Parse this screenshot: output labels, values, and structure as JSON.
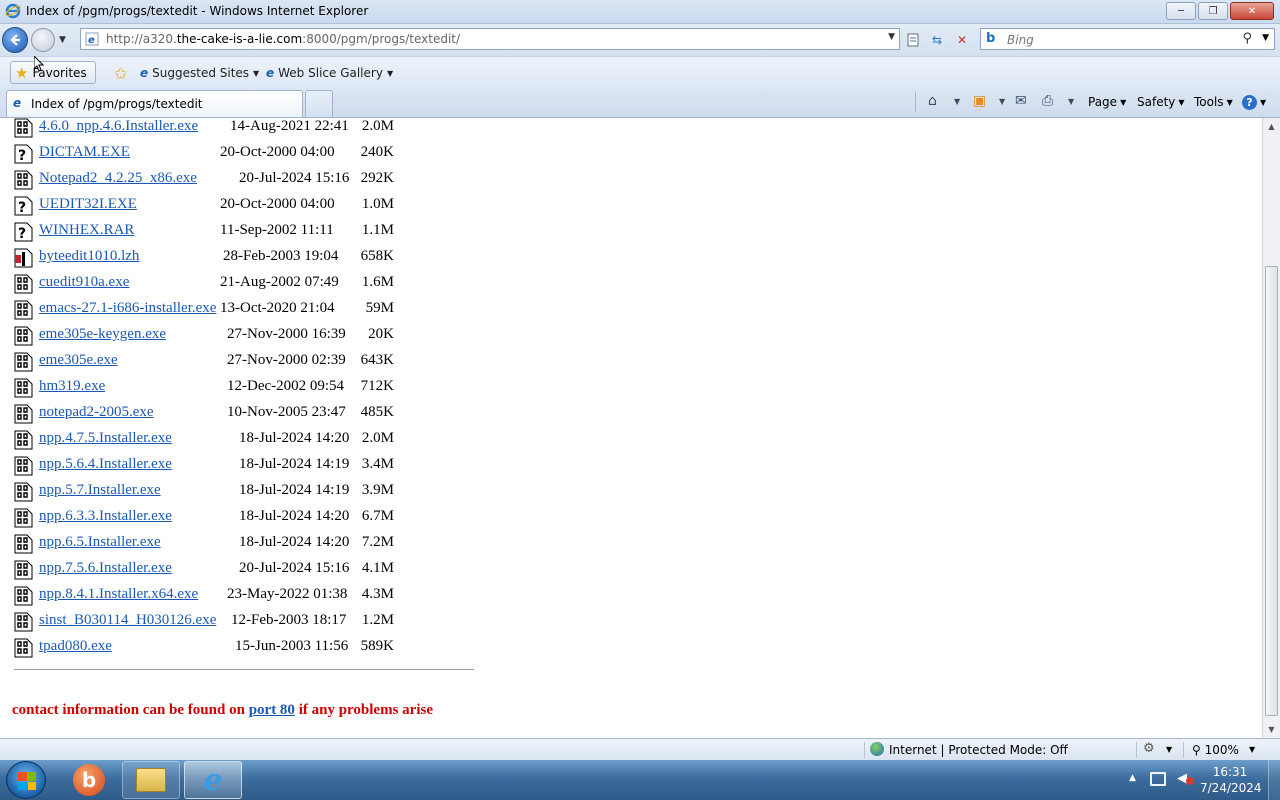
{
  "window": {
    "title": "Index of /pgm/progs/textedit - Windows Internet Explorer",
    "minimize": "─",
    "maximize": "❐",
    "close": "✕"
  },
  "address": {
    "url_prefix": "http://a320.",
    "url_domain": "the-cake-is-a-lie.com",
    "url_suffix": ":8000/pgm/progs/textedit/"
  },
  "search": {
    "placeholder": "Bing"
  },
  "favorites_bar": {
    "favorites_label": "Favorites",
    "links": [
      "Suggested Sites",
      "Web Slice Gallery"
    ]
  },
  "tabs": [
    {
      "label": "Index of /pgm/progs/textedit"
    }
  ],
  "command_bar": {
    "page": "Page",
    "safety": "Safety",
    "tools": "Tools",
    "help": "?"
  },
  "listing": [
    {
      "name": "4.6.0_npp.4.6.Installer.exe",
      "date": "14-Aug-2021 22:41",
      "size": "2.0M",
      "icon": "binary-file-icon"
    },
    {
      "name": "DICTAM.EXE",
      "date": "20-Oct-2000 04:00",
      "size": "240K",
      "icon": "unknown-file-icon"
    },
    {
      "name": "Notepad2_4.2.25_x86.exe",
      "date": "20-Jul-2024 15:16",
      "size": "292K",
      "icon": "binary-file-icon"
    },
    {
      "name": "UEDIT32I.EXE",
      "date": "20-Oct-2000 04:00",
      "size": "1.0M",
      "icon": "unknown-file-icon"
    },
    {
      "name": "WINHEX.RAR",
      "date": "11-Sep-2002 11:11",
      "size": "1.1M",
      "icon": "unknown-file-icon"
    },
    {
      "name": "byteedit1010.lzh",
      "date": "28-Feb-2003 19:04",
      "size": "658K",
      "icon": "compressed-file-icon"
    },
    {
      "name": "cuedit910a.exe",
      "date": "21-Aug-2002 07:49",
      "size": "1.6M",
      "icon": "binary-file-icon"
    },
    {
      "name": "emacs-27.1-i686-installer.exe",
      "date": "13-Oct-2020 21:04",
      "size": "59M",
      "icon": "binary-file-icon"
    },
    {
      "name": "eme305e-keygen.exe",
      "date": "27-Nov-2000 16:39",
      "size": "20K",
      "icon": "binary-file-icon"
    },
    {
      "name": "eme305e.exe",
      "date": "27-Nov-2000 02:39",
      "size": "643K",
      "icon": "binary-file-icon"
    },
    {
      "name": "hm319.exe",
      "date": "12-Dec-2002 09:54",
      "size": "712K",
      "icon": "binary-file-icon"
    },
    {
      "name": "notepad2-2005.exe",
      "date": "10-Nov-2005 23:47",
      "size": "485K",
      "icon": "binary-file-icon"
    },
    {
      "name": "npp.4.7.5.Installer.exe",
      "date": "18-Jul-2024 14:20",
      "size": "2.0M",
      "icon": "binary-file-icon"
    },
    {
      "name": "npp.5.6.4.Installer.exe",
      "date": "18-Jul-2024 14:19",
      "size": "3.4M",
      "icon": "binary-file-icon"
    },
    {
      "name": "npp.5.7.Installer.exe",
      "date": "18-Jul-2024 14:19",
      "size": "3.9M",
      "icon": "binary-file-icon"
    },
    {
      "name": "npp.6.3.3.Installer.exe",
      "date": "18-Jul-2024 14:20",
      "size": "6.7M",
      "icon": "binary-file-icon"
    },
    {
      "name": "npp.6.5.Installer.exe",
      "date": "18-Jul-2024 14:20",
      "size": "7.2M",
      "icon": "binary-file-icon"
    },
    {
      "name": "npp.7.5.6.Installer.exe",
      "date": "20-Jul-2024 15:16",
      "size": "4.1M",
      "icon": "binary-file-icon"
    },
    {
      "name": "npp.8.4.1.Installer.x64.exe",
      "date": "23-May-2022 01:38",
      "size": "4.3M",
      "icon": "binary-file-icon"
    },
    {
      "name": "sinst_B030114_H030126.exe",
      "date": "12-Feb-2003 18:17",
      "size": "1.2M",
      "icon": "binary-file-icon"
    },
    {
      "name": "tpad080.exe",
      "date": "15-Jun-2003 11:56",
      "size": "589K",
      "icon": "binary-file-icon"
    }
  ],
  "footer": {
    "before": "contact information can be found on ",
    "link": "port 80",
    "after": " if any problems arise"
  },
  "status": {
    "zone": "Internet | Protected Mode: Off",
    "zoom": "100%"
  },
  "taskbar": {
    "time": "16:31",
    "date": "7/24/2024",
    "apps": [
      "browser-b-icon",
      "file-explorer-icon",
      "internet-explorer-icon"
    ]
  }
}
